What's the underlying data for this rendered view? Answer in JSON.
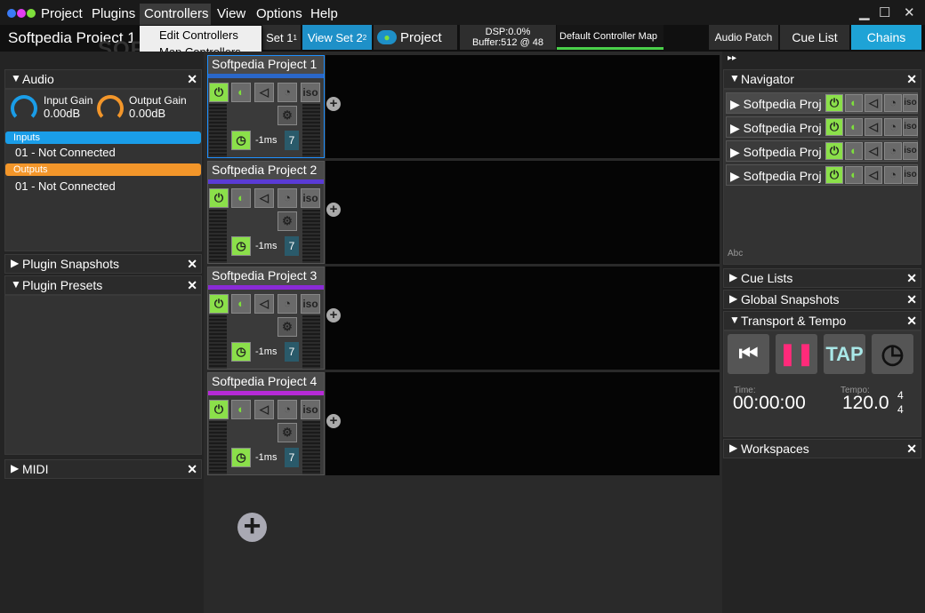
{
  "menu": {
    "project": "Project",
    "plugins": "Plugins",
    "controllers": "Controllers",
    "view": "View",
    "options": "Options",
    "help": "Help"
  },
  "dropdown": {
    "edit": "Edit Controllers",
    "map": "Map Controllers"
  },
  "toolbar": {
    "project_title": "Softpedia Project 1",
    "set1": "Set 1",
    "set1_num": "1",
    "viewset2": "View Set 2",
    "viewset2_num": "2",
    "project_btn": "Project",
    "dsp": "DSP:0.0%",
    "buffer": "Buffer:512 @ 48",
    "controller_map": "Default Controller Map",
    "audio_patch": "Audio Patch",
    "cue_list": "Cue List",
    "chains": "Chains",
    "chains_color": "#1ea3d6"
  },
  "audio": {
    "title": "Audio",
    "input_gain_label": "Input Gain",
    "input_gain_value": "0.00dB",
    "output_gain_label": "Output Gain",
    "output_gain_value": "0.00dB",
    "inputs_label": "Inputs",
    "inputs_color": "#1a9de8",
    "input_item": "01 - Not Connected",
    "outputs_label": "Outputs",
    "outputs_color": "#f3962a",
    "output_item": "01 - Not Connected"
  },
  "left_panels": {
    "plugin_snapshots": "Plugin Snapshots",
    "plugin_presets": "Plugin Presets",
    "midi": "MIDI"
  },
  "tracks": [
    {
      "name": "Softpedia Project 1",
      "latency": "-1ms",
      "num": "7",
      "color": "#2a67c9"
    },
    {
      "name": "Softpedia Project 2",
      "latency": "-1ms",
      "num": "7",
      "color": "#5a3bd6"
    },
    {
      "name": "Softpedia Project 3",
      "latency": "-1ms",
      "num": "7",
      "color": "#8a2ad6"
    },
    {
      "name": "Softpedia Project 4",
      "latency": "-1ms",
      "num": "7",
      "color": "#b62ad6"
    }
  ],
  "navigator": {
    "title": "Navigator",
    "rows": [
      "Softpedia Proj",
      "Softpedia Proj",
      "Softpedia Proj",
      "Softpedia Proj"
    ],
    "abc": "Abc"
  },
  "right_panels": {
    "cue_lists": "Cue Lists",
    "global_snapshots": "Global Snapshots",
    "transport": "Transport & Tempo",
    "workspaces": "Workspaces"
  },
  "transport": {
    "time_label": "Time:",
    "time_value": "00:00:00",
    "tempo_label": "Tempo:",
    "tempo_value": "120.0",
    "sig_top": "4",
    "sig_bottom": "4",
    "tap": "TAP",
    "pause_color": "#ff2a7a",
    "skip_color": "#ffffff"
  },
  "icons": {
    "power": "power-icon",
    "snap": "snapshot-icon",
    "mute": "speaker-icon",
    "gauge": "gauge-icon",
    "iso": "iso"
  },
  "watermark": "SOFTPEDIA"
}
